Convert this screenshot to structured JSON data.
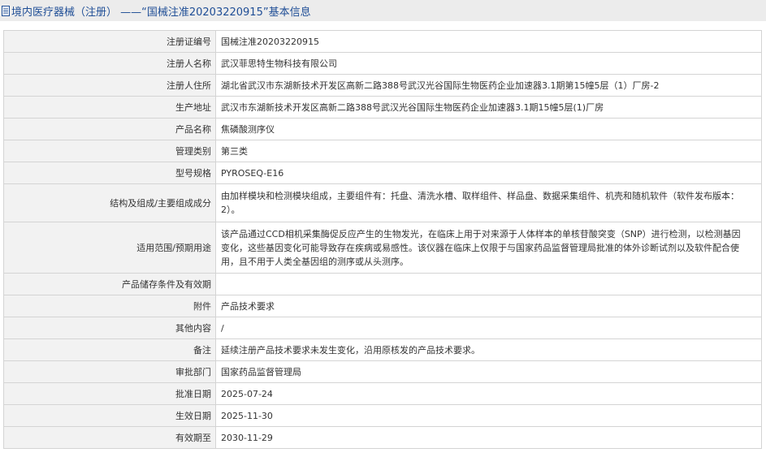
{
  "header": {
    "title": "境内医疗器械（注册）  ——“国械注准20203220915”基本信息"
  },
  "rows": [
    {
      "label": "注册证编号",
      "value": "国械注准20203220915"
    },
    {
      "label": "注册人名称",
      "value": "武汉菲思特生物科技有限公司"
    },
    {
      "label": "注册人住所",
      "value": "湖北省武汉市东湖新技术开发区高新二路388号武汉光谷国际生物医药企业加速器3.1期第15幢5层（1）厂房-2"
    },
    {
      "label": "生产地址",
      "value": "武汉市东湖新技术开发区高新二路388号武汉光谷国际生物医药企业加速器3.1期15幢5层(1)厂房"
    },
    {
      "label": "产品名称",
      "value": "焦磷酸测序仪"
    },
    {
      "label": "管理类别",
      "value": "第三类"
    },
    {
      "label": "型号规格",
      "value": "PYROSEQ-E16"
    },
    {
      "label": "结构及组成/主要组成成分",
      "value": "由加样模块和检测模块组成，主要组件有：托盘、清洗水槽、取样组件、样品盘、数据采集组件、机壳和随机软件（软件发布版本：2）。"
    },
    {
      "label": "适用范围/预期用途",
      "value": "该产品通过CCD相机采集酶促反应产生的生物发光，在临床上用于对来源于人体样本的单核苷酸突变（SNP）进行检测，以检测基因变化，这些基因变化可能导致存在疾病或易感性。该仪器在临床上仅限于与国家药品监督管理局批准的体外诊断试剂以及软件配合使用，且不用于人类全基因组的测序或从头测序。"
    },
    {
      "label": "产品储存条件及有效期",
      "value": ""
    },
    {
      "label": "附件",
      "value": "产品技术要求"
    },
    {
      "label": "其他内容",
      "value": "/"
    },
    {
      "label": "备注",
      "value": "延续注册产品技术要求未发生变化，沿用原核发的产品技术要求。"
    },
    {
      "label": "审批部门",
      "value": "国家药品监督管理局"
    },
    {
      "label": "批准日期",
      "value": "2025-07-24"
    },
    {
      "label": "生效日期",
      "value": "2025-11-30"
    },
    {
      "label": "有效期至",
      "value": "2030-11-29"
    }
  ]
}
